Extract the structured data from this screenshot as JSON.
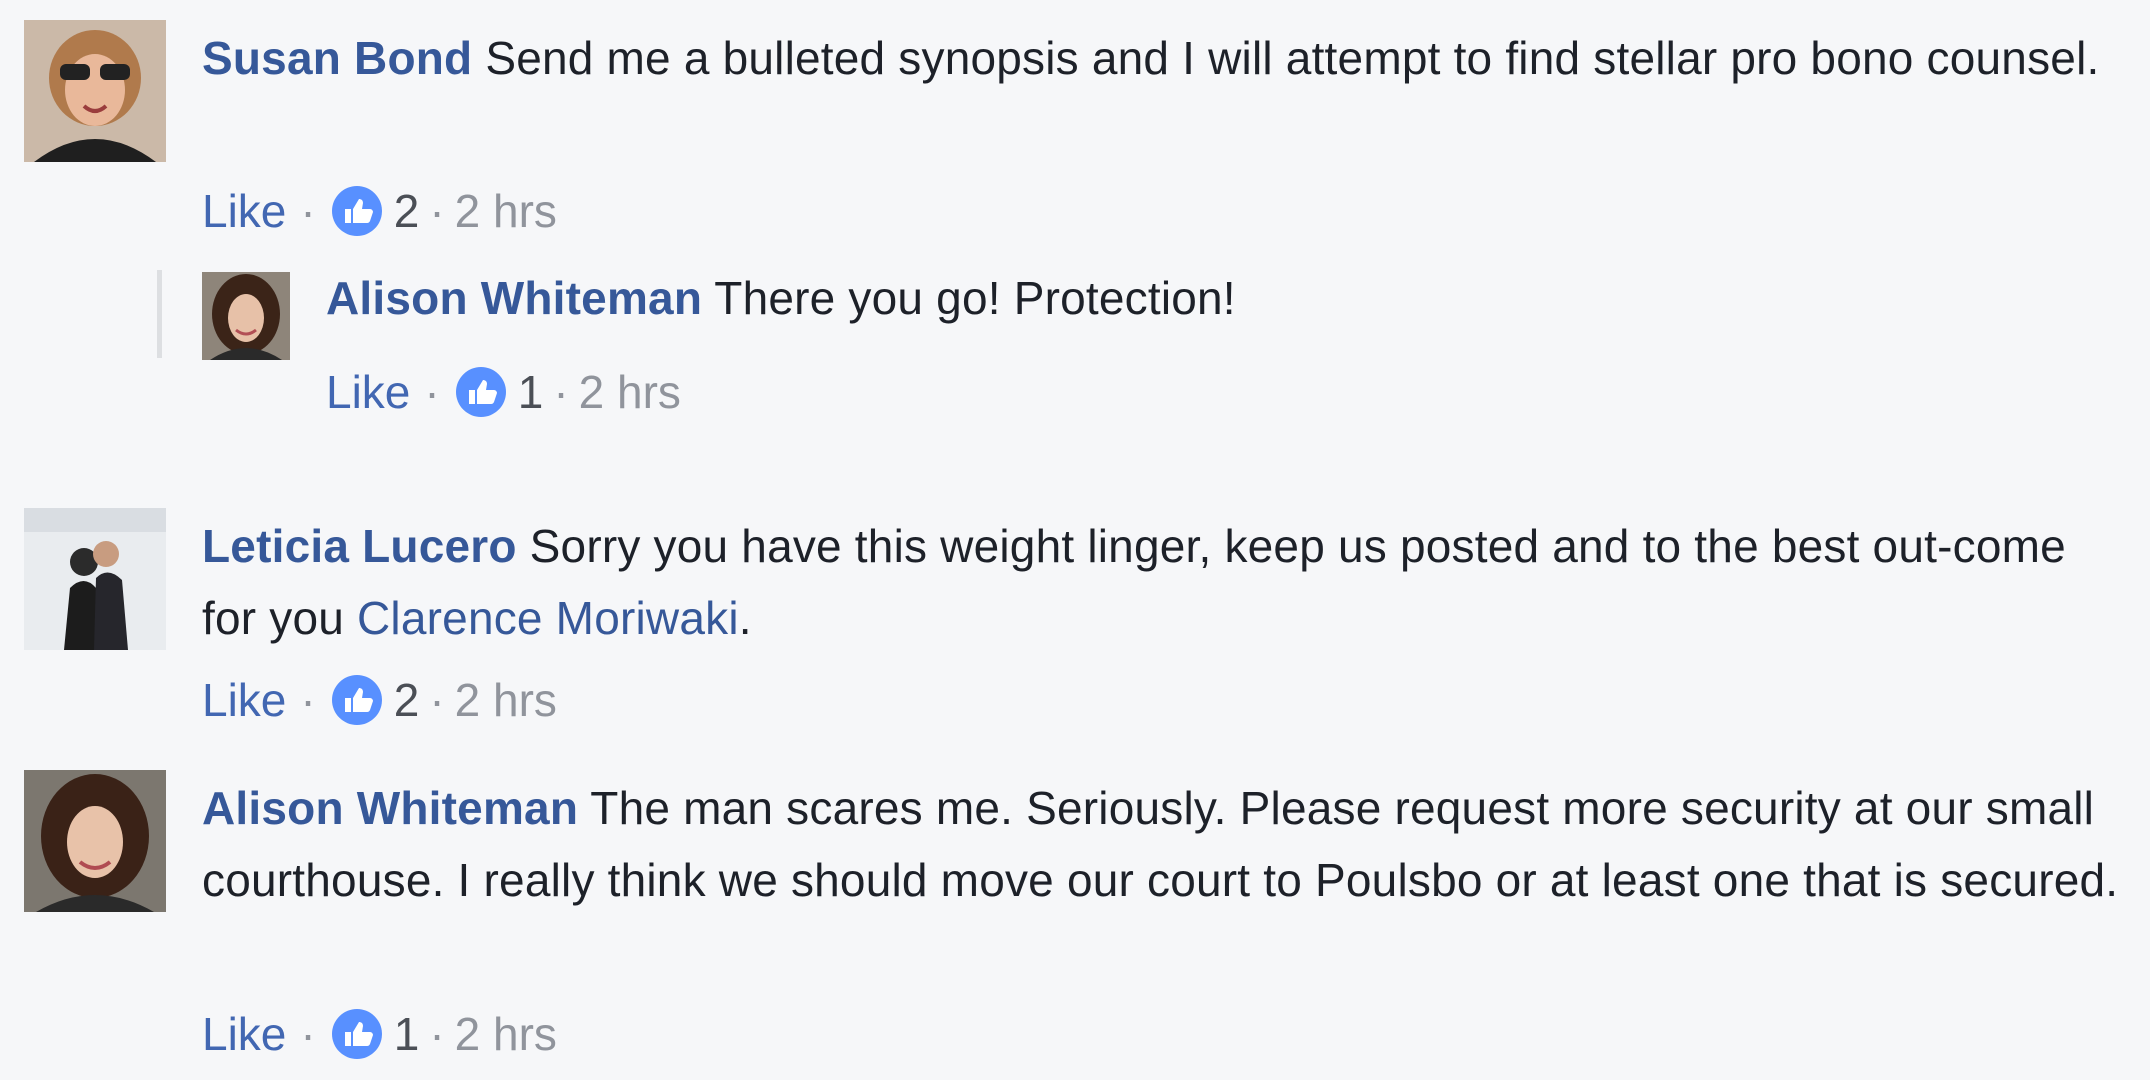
{
  "comments": [
    {
      "author": "Susan Bond",
      "text": " Send me a bulleted synopsis and I will attempt to find stellar pro bono counsel.",
      "like_label": "Like",
      "reaction_count": "2",
      "time": "2 hrs"
    },
    {
      "author": "Alison Whiteman",
      "text": " There you go! Protection!",
      "like_label": "Like",
      "reaction_count": "1",
      "time": "2 hrs"
    },
    {
      "author": "Leticia Lucero",
      "text_before": " Sorry you have this weight linger, keep us posted and to the best out-come for you ",
      "mention": "Clarence Moriwaki",
      "text_after": ".",
      "like_label": "Like",
      "reaction_count": "2",
      "time": "2 hrs"
    },
    {
      "author": "Alison Whiteman",
      "text": " The man scares me. Seriously. Please request more security at our small courthouse. I really think we should move our court to Poulsbo or at least one that is secured.",
      "like_label": "Like",
      "reaction_count": "1",
      "time": "2 hrs"
    }
  ],
  "separator": "·",
  "icons": {
    "reaction": "thumbs-up-icon"
  },
  "colors": {
    "author": "#365899",
    "like": "#4267b2",
    "meta": "#90949c",
    "reaction_badge": "#5890ff",
    "background": "#f6f7f9"
  }
}
